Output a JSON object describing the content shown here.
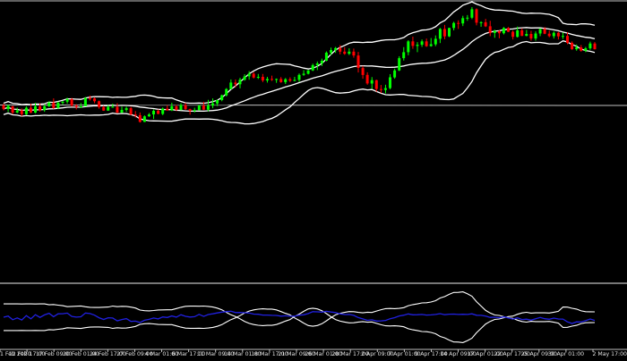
{
  "chart_data": {
    "type": "line",
    "title": "",
    "grid": false,
    "main_panel": {
      "series": [
        {
          "role": "bollinger-upper",
          "color": "#ffffff"
        },
        {
          "role": "bollinger-middle",
          "color": "#ffffff"
        },
        {
          "role": "bollinger-lower",
          "color": "#ffffff"
        },
        {
          "role": "candles",
          "up_color": "#00ff00",
          "down_color": "#ff0000"
        }
      ],
      "horizontal_line": {
        "value": 0.5,
        "color": "#c0c0c0"
      },
      "ylim": [
        0,
        1
      ]
    },
    "sub_panel": {
      "series": [
        {
          "role": "oscillator-white",
          "color": "#ffffff"
        },
        {
          "role": "oscillator-blue",
          "color": "#2020e0"
        }
      ],
      "ylim": [
        -1,
        1
      ]
    },
    "x_tick_labels": [
      "1 Feb 2020",
      "12 Feb 17:00",
      "17 Feb 09:00",
      "20 Feb 01:00",
      "24 Feb 17:00",
      "27 Feb 09:00",
      "4 Mar 01:00",
      "6 Mar 17:00",
      "11 Mar 09:00",
      "14 Mar 01:00",
      "18 Mar 17:00",
      "21 Mar 09:00",
      "26 Mar 01:00",
      "28 Mar 17:00",
      "2 Apr 09:00",
      "7 Apr 01:00",
      "9 Apr 17:00",
      "14 Apr 09:00",
      "17 Apr 01:00",
      "22 Apr 17:00",
      "25 Apr 09:00",
      "30 Apr 01:00",
      "2 May 17:00"
    ],
    "ohlc": [
      [
        0.59,
        0.597,
        0.569,
        0.575
      ],
      [
        0.575,
        0.593,
        0.562,
        0.588
      ],
      [
        0.586,
        0.588,
        0.553,
        0.56
      ],
      [
        0.56,
        0.58,
        0.557,
        0.569
      ],
      [
        0.569,
        0.577,
        0.544,
        0.553
      ],
      [
        0.553,
        0.586,
        0.549,
        0.58
      ],
      [
        0.58,
        0.597,
        0.557,
        0.56
      ],
      [
        0.56,
        0.6,
        0.557,
        0.586
      ],
      [
        0.586,
        0.598,
        0.564,
        0.57
      ],
      [
        0.57,
        0.594,
        0.563,
        0.586
      ],
      [
        0.586,
        0.607,
        0.583,
        0.601
      ],
      [
        0.601,
        0.619,
        0.575,
        0.579
      ],
      [
        0.579,
        0.606,
        0.574,
        0.601
      ],
      [
        0.601,
        0.608,
        0.593,
        0.605
      ],
      [
        0.605,
        0.622,
        0.597,
        0.616
      ],
      [
        0.616,
        0.621,
        0.584,
        0.589
      ],
      [
        0.589,
        0.595,
        0.573,
        0.583
      ],
      [
        0.583,
        0.6,
        0.579,
        0.586
      ],
      [
        0.586,
        0.625,
        0.586,
        0.62
      ],
      [
        0.62,
        0.631,
        0.61,
        0.619
      ],
      [
        0.619,
        0.624,
        0.599,
        0.607
      ],
      [
        0.607,
        0.61,
        0.576,
        0.583
      ],
      [
        0.583,
        0.588,
        0.567,
        0.568
      ],
      [
        0.568,
        0.591,
        0.567,
        0.584
      ],
      [
        0.584,
        0.597,
        0.581,
        0.584
      ],
      [
        0.584,
        0.599,
        0.558,
        0.559
      ],
      [
        0.559,
        0.585,
        0.559,
        0.571
      ],
      [
        0.571,
        0.585,
        0.563,
        0.578
      ],
      [
        0.578,
        0.584,
        0.549,
        0.552
      ],
      [
        0.552,
        0.566,
        0.539,
        0.549
      ],
      [
        0.549,
        0.56,
        0.518,
        0.521
      ],
      [
        0.521,
        0.548,
        0.52,
        0.544
      ],
      [
        0.544,
        0.558,
        0.542,
        0.552
      ],
      [
        0.552,
        0.573,
        0.533,
        0.567
      ],
      [
        0.567,
        0.573,
        0.553,
        0.554
      ],
      [
        0.554,
        0.581,
        0.549,
        0.576
      ],
      [
        0.576,
        0.59,
        0.567,
        0.569
      ],
      [
        0.569,
        0.601,
        0.566,
        0.586
      ],
      [
        0.586,
        0.592,
        0.566,
        0.571
      ],
      [
        0.571,
        0.599,
        0.569,
        0.591
      ],
      [
        0.591,
        0.6,
        0.571,
        0.574
      ],
      [
        0.574,
        0.576,
        0.551,
        0.567
      ],
      [
        0.567,
        0.58,
        0.56,
        0.57
      ],
      [
        0.57,
        0.592,
        0.568,
        0.589
      ],
      [
        0.589,
        0.605,
        0.57,
        0.572
      ],
      [
        0.572,
        0.613,
        0.565,
        0.589
      ],
      [
        0.589,
        0.619,
        0.578,
        0.598
      ],
      [
        0.598,
        0.614,
        0.587,
        0.612
      ],
      [
        0.612,
        0.635,
        0.607,
        0.632
      ],
      [
        0.632,
        0.662,
        0.627,
        0.658
      ],
      [
        0.658,
        0.698,
        0.657,
        0.685
      ],
      [
        0.685,
        0.698,
        0.665,
        0.678
      ],
      [
        0.678,
        0.705,
        0.661,
        0.697
      ],
      [
        0.697,
        0.72,
        0.693,
        0.711
      ],
      [
        0.711,
        0.733,
        0.697,
        0.722
      ],
      [
        0.722,
        0.729,
        0.702,
        0.706
      ],
      [
        0.706,
        0.721,
        0.7,
        0.709
      ],
      [
        0.709,
        0.721,
        0.687,
        0.694
      ],
      [
        0.694,
        0.709,
        0.685,
        0.7
      ],
      [
        0.7,
        0.714,
        0.692,
        0.697
      ],
      [
        0.697,
        0.702,
        0.684,
        0.7
      ],
      [
        0.7,
        0.708,
        0.684,
        0.687
      ],
      [
        0.687,
        0.704,
        0.679,
        0.699
      ],
      [
        0.699,
        0.707,
        0.687,
        0.693
      ],
      [
        0.693,
        0.709,
        0.69,
        0.696
      ],
      [
        0.696,
        0.723,
        0.688,
        0.717
      ],
      [
        0.717,
        0.737,
        0.713,
        0.722
      ],
      [
        0.722,
        0.738,
        0.719,
        0.736
      ],
      [
        0.736,
        0.764,
        0.733,
        0.758
      ],
      [
        0.758,
        0.773,
        0.737,
        0.765
      ],
      [
        0.765,
        0.785,
        0.754,
        0.776
      ],
      [
        0.776,
        0.815,
        0.774,
        0.81
      ],
      [
        0.81,
        0.831,
        0.8,
        0.821
      ],
      [
        0.821,
        0.834,
        0.809,
        0.829
      ],
      [
        0.829,
        0.842,
        0.803,
        0.814
      ],
      [
        0.814,
        0.833,
        0.801,
        0.805
      ],
      [
        0.805,
        0.828,
        0.8,
        0.814
      ],
      [
        0.814,
        0.827,
        0.789,
        0.798
      ],
      [
        0.798,
        0.813,
        0.727,
        0.746
      ],
      [
        0.746,
        0.755,
        0.701,
        0.717
      ],
      [
        0.717,
        0.728,
        0.676,
        0.681
      ],
      [
        0.681,
        0.708,
        0.658,
        0.695
      ],
      [
        0.695,
        0.697,
        0.647,
        0.658
      ],
      [
        0.658,
        0.675,
        0.641,
        0.654
      ],
      [
        0.654,
        0.676,
        0.64,
        0.662
      ],
      [
        0.662,
        0.72,
        0.657,
        0.707
      ],
      [
        0.707,
        0.743,
        0.701,
        0.736
      ],
      [
        0.736,
        0.795,
        0.733,
        0.787
      ],
      [
        0.787,
        0.833,
        0.777,
        0.812
      ],
      [
        0.812,
        0.862,
        0.799,
        0.857
      ],
      [
        0.857,
        0.877,
        0.826,
        0.838
      ],
      [
        0.838,
        0.854,
        0.812,
        0.843
      ],
      [
        0.843,
        0.865,
        0.834,
        0.857
      ],
      [
        0.857,
        0.869,
        0.834,
        0.837
      ],
      [
        0.837,
        0.871,
        0.835,
        0.845
      ],
      [
        0.845,
        0.882,
        0.837,
        0.868
      ],
      [
        0.868,
        0.913,
        0.85,
        0.909
      ],
      [
        0.909,
        0.926,
        0.866,
        0.878
      ],
      [
        0.878,
        0.914,
        0.875,
        0.913
      ],
      [
        0.913,
        0.939,
        0.903,
        0.934
      ],
      [
        0.934,
        0.945,
        0.909,
        0.932
      ],
      [
        0.932,
        0.964,
        0.921,
        0.954
      ],
      [
        0.954,
        0.967,
        0.943,
        0.956
      ],
      [
        0.956,
        1.0,
        0.95,
        0.991
      ],
      [
        0.991,
        0.995,
        0.924,
        0.935
      ],
      [
        0.935,
        0.941,
        0.918,
        0.937
      ],
      [
        0.937,
        0.951,
        0.917,
        0.92
      ],
      [
        0.92,
        0.943,
        0.879,
        0.892
      ],
      [
        0.892,
        0.906,
        0.872,
        0.9
      ],
      [
        0.9,
        0.903,
        0.87,
        0.891
      ],
      [
        0.891,
        0.917,
        0.886,
        0.913
      ],
      [
        0.913,
        0.917,
        0.896,
        0.897
      ],
      [
        0.897,
        0.903,
        0.865,
        0.876
      ],
      [
        0.876,
        0.919,
        0.873,
        0.903
      ],
      [
        0.903,
        0.912,
        0.879,
        0.88
      ],
      [
        0.88,
        0.905,
        0.878,
        0.888
      ],
      [
        0.888,
        0.901,
        0.86,
        0.869
      ],
      [
        0.869,
        0.899,
        0.86,
        0.89
      ],
      [
        0.89,
        0.911,
        0.879,
        0.909
      ],
      [
        0.909,
        0.917,
        0.887,
        0.889
      ],
      [
        0.889,
        0.902,
        0.874,
        0.879
      ],
      [
        0.879,
        0.899,
        0.869,
        0.893
      ],
      [
        0.893,
        0.897,
        0.865,
        0.878
      ],
      [
        0.878,
        0.894,
        0.867,
        0.88
      ],
      [
        0.88,
        0.895,
        0.845,
        0.851
      ],
      [
        0.851,
        0.857,
        0.822,
        0.824
      ],
      [
        0.824,
        0.844,
        0.818,
        0.832
      ],
      [
        0.832,
        0.842,
        0.814,
        0.818
      ],
      [
        0.818,
        0.834,
        0.812,
        0.828
      ],
      [
        0.828,
        0.856,
        0.822,
        0.848
      ],
      [
        0.848,
        0.854,
        0.823,
        0.824
      ]
    ]
  }
}
